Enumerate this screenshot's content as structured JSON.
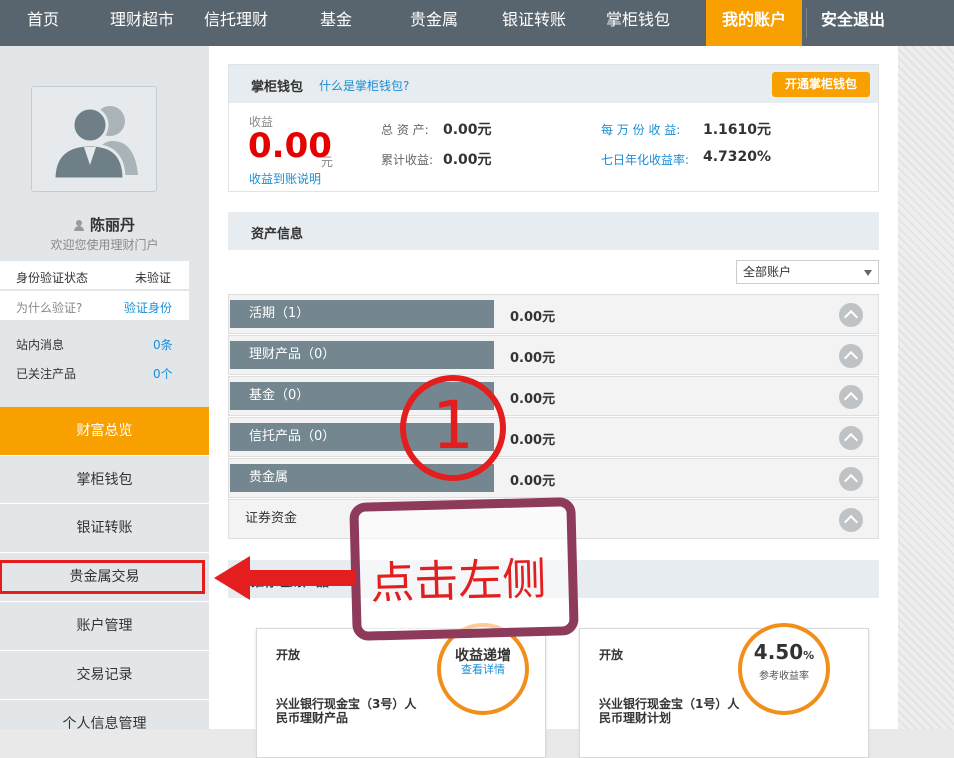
{
  "nav": {
    "items": [
      "首页",
      "理财超市",
      "信托理财",
      "基金",
      "贵金属",
      "银证转账",
      "掌柜钱包",
      "我的账户",
      "安全退出"
    ],
    "active": "我的账户"
  },
  "sidebar": {
    "username": "陈丽丹",
    "welcome": "欢迎您使用理财门户",
    "verify": {
      "status_label": "身份验证状态",
      "status_value": "未验证",
      "why_label": "为什么验证?",
      "verify_link": "验证身份"
    },
    "messages": {
      "label": "站内消息",
      "value": "0条"
    },
    "follow": {
      "label": "已关注产品",
      "value": "0个"
    },
    "menu": [
      "财富总览",
      "掌柜钱包",
      "银证转账",
      "贵金属交易",
      "账户管理",
      "交易记录",
      "个人信息管理"
    ],
    "menu_active": "财富总览"
  },
  "wallet": {
    "title": "掌柜钱包",
    "what_link": "什么是掌柜钱包?",
    "open_button": "开通掌柜钱包",
    "income_label": "收益",
    "income_value": "0.00",
    "income_unit": "元",
    "income_note": "收益到账说明",
    "total_assets_label": "总 资 产:",
    "total_assets_value": "0.00元",
    "cum_income_label": "累计收益:",
    "cum_income_value": "0.00元",
    "per_10k_label": "每 万 份 收 益:",
    "per_10k_value": "1.1610元",
    "seven_day_label": "七日年化收益率:",
    "seven_day_value": "4.7320%"
  },
  "assets": {
    "title": "资产信息",
    "account_select": "全部账户",
    "rows": [
      {
        "label": "活期（1）",
        "value": "0.00元"
      },
      {
        "label": "理财产品（0）",
        "value": "0.00元"
      },
      {
        "label": "基金（0）",
        "value": "0.00元"
      },
      {
        "label": "信托产品（0）",
        "value": "0.00元"
      },
      {
        "label": "贵金属",
        "value": "0.00元"
      },
      {
        "label": "证券资金",
        "value": ""
      }
    ]
  },
  "recommend": {
    "title": "推荐理财产品",
    "cards": [
      {
        "status": "开放",
        "badge_main": "收益递增",
        "badge_sub": "查看详情",
        "name_line1": "兴业银行现金宝（3号）人",
        "name_line2": "民币理财产品"
      },
      {
        "status": "开放",
        "rate": "4.50",
        "rate_unit": "%",
        "rate_label": "参考收益率",
        "name_line1": "兴业银行现金宝（1号）人",
        "name_line2": "民币理财计划"
      }
    ]
  },
  "annotation": {
    "number": "1",
    "text": "点击左侧",
    "colors": {
      "red": "#e41e1e",
      "maroon": "#8e3a5a"
    }
  },
  "colors": {
    "orange": "#f7a000",
    "nav": "#58656e",
    "link": "#1a8ed6",
    "income_red": "#e60000"
  }
}
